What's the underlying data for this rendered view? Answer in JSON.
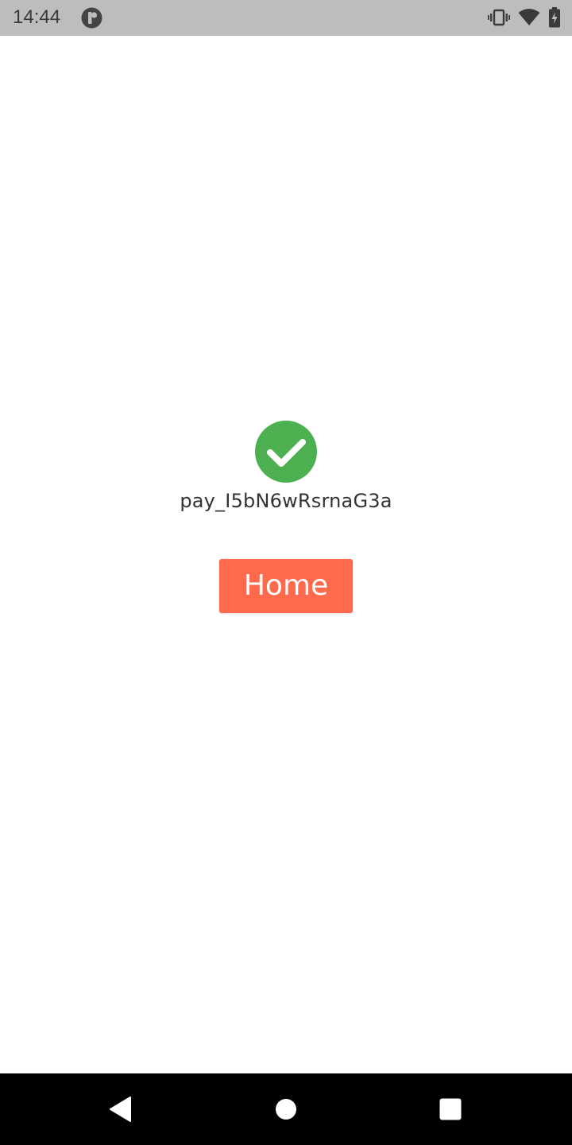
{
  "status_bar": {
    "time": "14:44",
    "left_icon": "notification-app-icon",
    "icons": [
      "vibrate-icon",
      "wifi-icon",
      "battery-charging-icon"
    ]
  },
  "main": {
    "status_icon": "check-circle-icon",
    "status_color": "#4caf50",
    "payment_id": "pay_I5bN6wRsrnaG3a",
    "home_button_label": "Home",
    "home_button_color": "#ff6a4d"
  },
  "nav_bar": {
    "buttons": [
      "back-icon",
      "home-icon",
      "recents-icon"
    ]
  }
}
